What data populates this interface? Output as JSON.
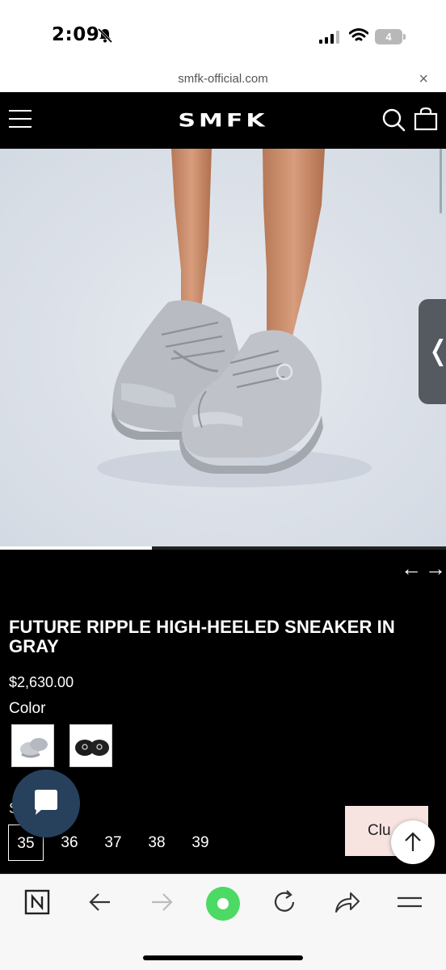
{
  "status_bar": {
    "time": "2:09",
    "battery": "4"
  },
  "url_bar": {
    "url": "smfk-official.com",
    "close": "×"
  },
  "header": {
    "logo": "SMFK"
  },
  "gallery": {
    "slide_progress": 0.34,
    "prev": "←",
    "next": "→",
    "side_tab": "❬"
  },
  "product": {
    "title": "FUTURE RIPPLE HIGH-HEELED SNEAKER IN GRAY",
    "price": "$2,630.00",
    "color_label": "Color",
    "size_label": "S",
    "sizes": [
      "35",
      "36",
      "37",
      "38",
      "39"
    ],
    "selected_size": "35",
    "club_button": "Clu"
  },
  "colors": {
    "header_bg": "#000000",
    "image_bg": "#dfe4ec",
    "club_bg": "#f7e4e1",
    "chat_bg": "#27415d",
    "accent_green": "#4cd964"
  },
  "toolbar": {
    "items": [
      "n-logo-icon",
      "back-icon",
      "forward-icon",
      "home-dot-icon",
      "reload-icon",
      "share-icon",
      "menu-icon"
    ]
  }
}
